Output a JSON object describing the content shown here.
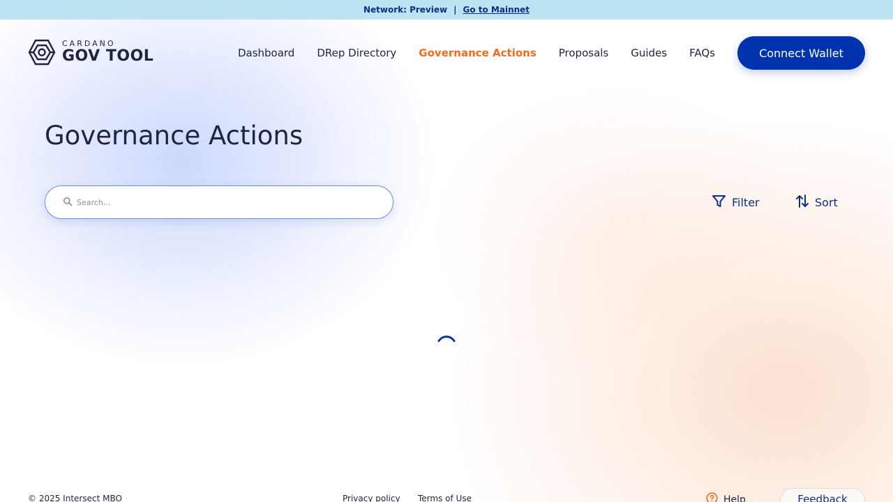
{
  "banner": {
    "network": "Network: Preview",
    "separator": "|",
    "mainnet_link": "Go to Mainnet"
  },
  "logo": {
    "small": "CARDANO",
    "big": "GOV TOOL"
  },
  "nav": {
    "items": [
      {
        "label": "Dashboard"
      },
      {
        "label": "DRep Directory"
      },
      {
        "label": "Governance Actions",
        "active": true
      },
      {
        "label": "Proposals"
      },
      {
        "label": "Guides"
      },
      {
        "label": "FAQs"
      }
    ],
    "connect_label": "Connect Wallet"
  },
  "main": {
    "title": "Governance Actions",
    "search": {
      "placeholder": "Search...",
      "value": ""
    },
    "filter_label": "Filter",
    "sort_label": "Sort"
  },
  "footer": {
    "copyright": "© 2025 Intersect MBO",
    "privacy": "Privacy policy",
    "terms": "Terms of Use",
    "help": "Help",
    "feedback": "Feedback"
  },
  "colors": {
    "primary": "#0033ad",
    "active_nav": "#f26b21",
    "banner_bg": "#bde4f2",
    "text_dark": "#1f2440"
  },
  "icons": {
    "logo": "hexagon-logo-icon",
    "search": "search-icon",
    "filter": "filter-icon",
    "sort": "sort-arrows-icon",
    "help": "help-circle-icon",
    "loading": "loading-spinner"
  }
}
